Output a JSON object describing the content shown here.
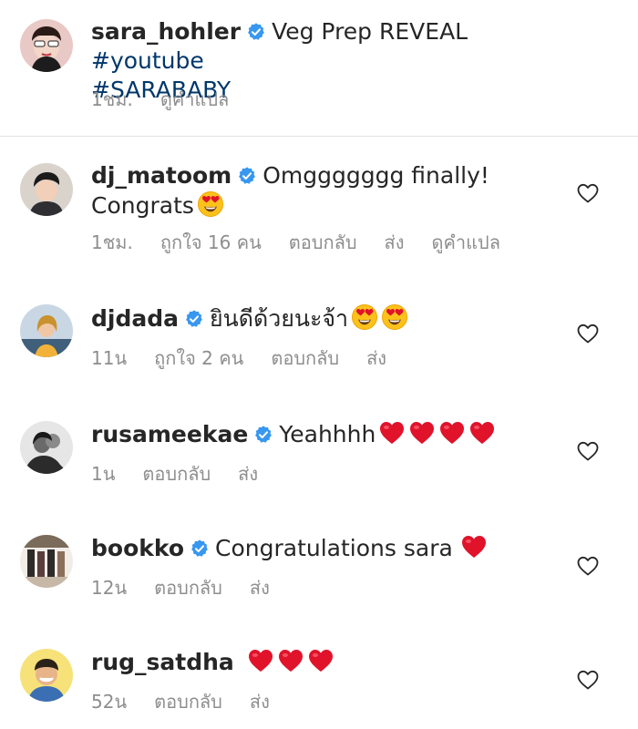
{
  "caption": {
    "username": "sara_hohler",
    "text": "Veg Prep REVEAL",
    "hashtag_1": "#youtube",
    "hashtag_2": "#SARABABY",
    "time": "1ชม.",
    "translate": "ดูคำแปล"
  },
  "comments": [
    {
      "username": "dj_matoom",
      "text": "Omggggggg finally!",
      "text_line2": "Congrats",
      "emojis": [
        "heart-eyes-emoji"
      ],
      "time": "1ชม.",
      "likes": "ถูกใจ 16 คน",
      "reply": "ตอบกลับ",
      "send": "ส่ง",
      "translate": "ดูคำแปล"
    },
    {
      "username": "djdada",
      "text": "ยินดีด้วยนะจ้า",
      "emojis": [
        "heart-eyes-emoji",
        "heart-eyes-emoji"
      ],
      "time": "11น",
      "likes": "ถูกใจ 2 คน",
      "reply": "ตอบกลับ",
      "send": "ส่ง"
    },
    {
      "username": "rusameekae",
      "text": "Yeahhhh",
      "emojis": [
        "red-heart-emoji",
        "red-heart-emoji",
        "red-heart-emoji",
        "red-heart-emoji"
      ],
      "time": "1น",
      "reply": "ตอบกลับ",
      "send": "ส่ง"
    },
    {
      "username": "bookko",
      "text": "Congratulations sara",
      "emojis": [
        "red-heart-emoji"
      ],
      "time": "12น",
      "reply": "ตอบกลับ",
      "send": "ส่ง"
    },
    {
      "username": "rug_satdha",
      "text": "",
      "emojis": [
        "red-heart-emoji",
        "red-heart-emoji",
        "red-heart-emoji"
      ],
      "time": "52น",
      "reply": "ตอบกลับ",
      "send": "ส่ง"
    }
  ],
  "colors": {
    "text": "#262626",
    "secondary": "#8e8e8e",
    "hashtag": "#00376b",
    "verified": "#3897f0",
    "heart_emoji": "#e0132b",
    "divider": "#e2e2e2"
  },
  "icons": {
    "verified": "verified-badge-icon",
    "like": "heart-outline-icon"
  }
}
